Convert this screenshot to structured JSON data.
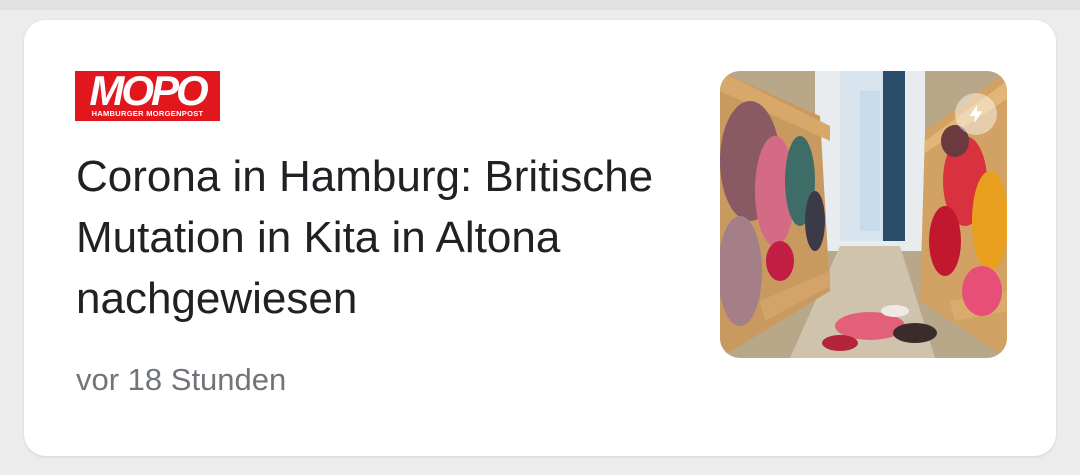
{
  "source": {
    "logo_main": "MOPO",
    "logo_sub": "HAMBURGER MORGENPOST"
  },
  "article": {
    "headline": "Corona in Hamburg: Britische Mutation in Kita in Altona nachgewiesen",
    "timestamp": "vor 18 Stunden"
  },
  "thumbnail": {
    "badge_icon": "lightning-bolt-icon"
  },
  "colors": {
    "brand_red": "#e2171e",
    "headline_text": "#202124",
    "meta_text": "#70757a",
    "card_bg": "#ffffff"
  }
}
